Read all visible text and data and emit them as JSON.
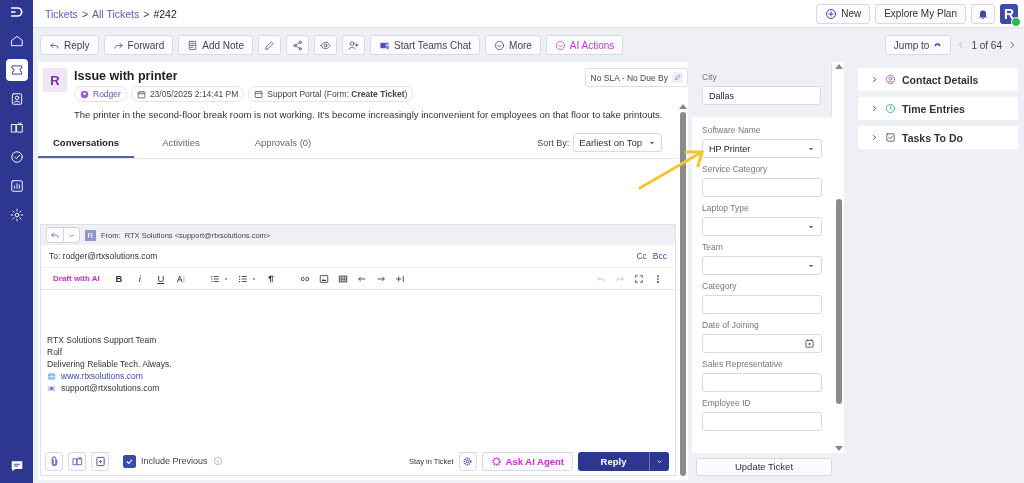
{
  "breadcrumb": [
    {
      "label": "Tickets",
      "kind": "link"
    },
    {
      "label": ">",
      "kind": "separator"
    },
    {
      "label": "All Tickets",
      "kind": "link"
    },
    {
      "label": ">",
      "kind": "separator"
    },
    {
      "label": "#242",
      "kind": "current"
    }
  ],
  "header_actions": {
    "new_button": "New",
    "plan_button": "Explore My Plan",
    "avatar": "R",
    "online": true
  },
  "nav": [
    {
      "kind": "home",
      "selected": false
    },
    {
      "kind": "ticket",
      "selected": true
    },
    {
      "kind": "contact",
      "selected": false
    },
    {
      "kind": "book",
      "selected": false
    },
    {
      "kind": "check",
      "selected": false
    },
    {
      "kind": "chart",
      "selected": false
    },
    {
      "kind": "settings",
      "selected": false
    }
  ],
  "toolbar": {
    "buttons": [
      {
        "label": "Reply",
        "kind": "reply"
      },
      {
        "label": "Forward",
        "kind": "forward"
      },
      {
        "label": "Add Note",
        "kind": "note"
      },
      {
        "kind": "edit"
      },
      {
        "kind": "share"
      },
      {
        "kind": "watch"
      },
      {
        "kind": "assign"
      },
      {
        "label": "Start Teams Chat",
        "kind": "teams"
      },
      {
        "label": "More",
        "kind": "more"
      },
      {
        "label": "AI Actions",
        "kind": "ai"
      }
    ],
    "jump_button": "Jump to",
    "pager": "1 of 64",
    "prev_disabled": true,
    "next_disabled": false
  },
  "ticket": {
    "avatar": "R",
    "title": "Issue with printer",
    "requester": "Rodger",
    "created": "23/05/2025 2:14:41 PM",
    "source": "Support Portal (Form: **Create Ticket**)",
    "sla": "No SLA - No Due By",
    "description": "The printer in the second-floor break room is not working. It's become increasingly inconvenient for employees on that floor to take printouts."
  },
  "tabs": [
    {
      "label": "Conversations",
      "selected": true
    },
    {
      "label": "Activities",
      "selected": false
    },
    {
      "label": "Approvals (0)",
      "selected": false
    }
  ],
  "sort": {
    "label": "Sort By:",
    "value": "Earliest on Top"
  },
  "composer": {
    "from_avatar": "R",
    "from": "From:  RTX Solutions <support@rtxsolutions.com>",
    "to": "To: rodger@rtxsolutions.com",
    "cc": "Cc",
    "bcc": "Bcc",
    "draft_ai": "Draft with AI",
    "format_buttons": [
      "B",
      "i",
      "U"
    ],
    "signature": [
      "RTX Solutions Support Team",
      "Rolf",
      "Delivering Reliable Tech. Always."
    ],
    "website": "www.rtxsolutions.com",
    "email": "support@rtxsolutions.com",
    "include_previous": {
      "label": "Include Previous",
      "checked": true
    },
    "stay_label": "Stay in Ticket",
    "ask_ai": "Ask AI Agent",
    "reply_button": "Reply"
  },
  "form": {
    "fields": [
      {
        "label": "City",
        "kind": "text",
        "value": "Dallas",
        "highlighted": true
      },
      {
        "label": "Software Name",
        "kind": "select",
        "value": "HP Printer",
        "highlighted": false
      },
      {
        "label": "Service Category",
        "kind": "text",
        "highlighted": false
      },
      {
        "label": "Laptop Type",
        "kind": "select",
        "highlighted": false
      },
      {
        "label": "Team",
        "kind": "select",
        "highlighted": false
      },
      {
        "label": "Category",
        "kind": "text",
        "highlighted": false
      },
      {
        "label": "Date of Joining",
        "kind": "date",
        "highlighted": false
      },
      {
        "label": "Sales Representative",
        "kind": "text",
        "highlighted": false
      },
      {
        "label": "Employee ID",
        "kind": "text",
        "highlighted": false
      }
    ],
    "update_button": "Update Ticket"
  },
  "panels": [
    {
      "title": "Contact Details",
      "kind": "contact",
      "expanded": false
    },
    {
      "title": "Time Entries",
      "kind": "time",
      "expanded": false
    },
    {
      "title": "Tasks To Do",
      "kind": "tasks",
      "expanded": false
    }
  ]
}
